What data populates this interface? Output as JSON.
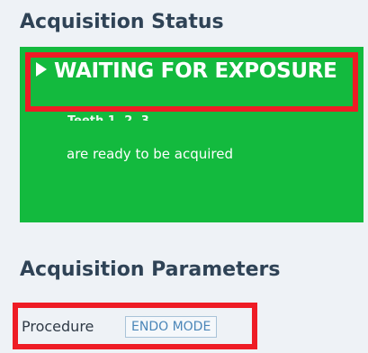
{
  "acquisition_status": {
    "title": "Acquisition Status",
    "headline": "WAITING FOR EXPOSURE",
    "subline": "Teeth 1, 2, 3",
    "description": "are ready to be acquired",
    "panel_color": "#13ba3e",
    "highlight_color": "#ee1c25"
  },
  "acquisition_parameters": {
    "title": "Acquisition Parameters",
    "procedure_label": "Procedure",
    "procedure_value": "ENDO MODE"
  },
  "icons": {
    "headline_icon": "play-icon"
  }
}
